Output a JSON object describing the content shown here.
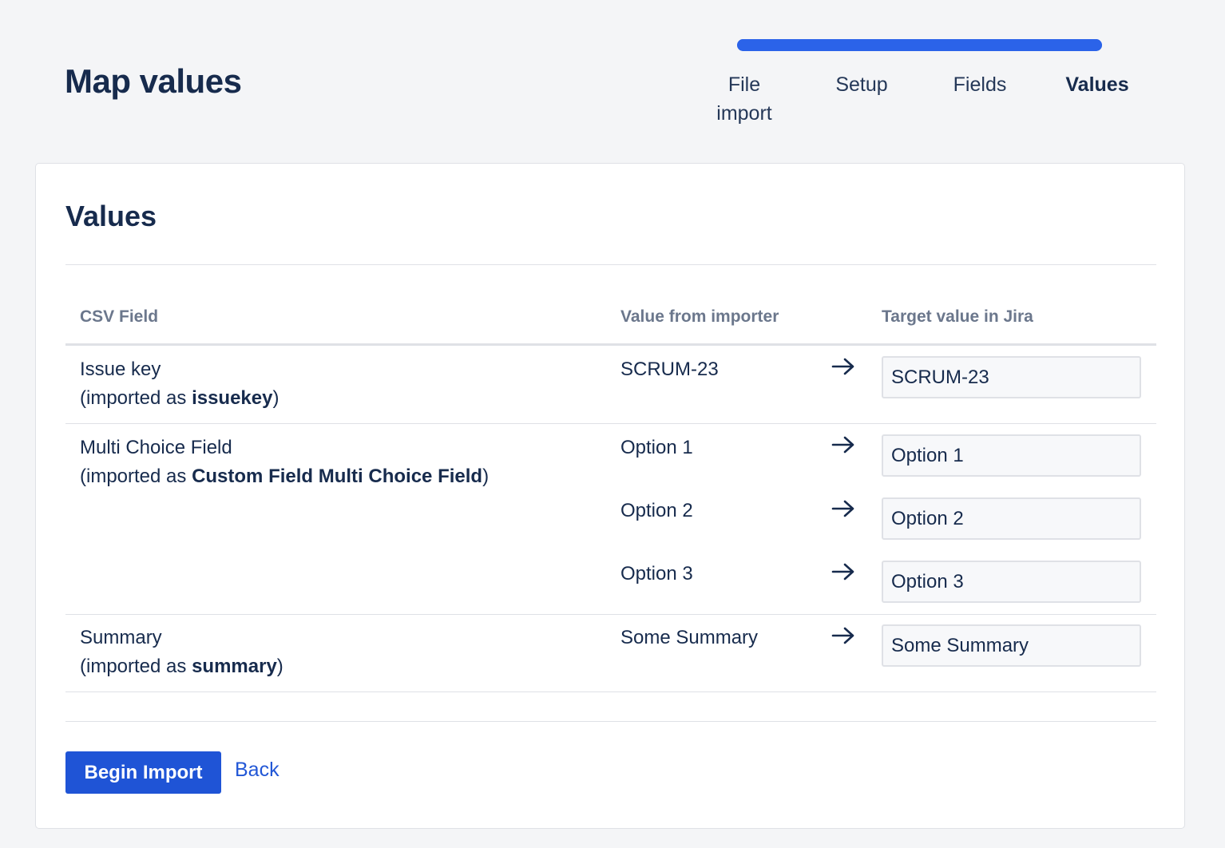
{
  "page": {
    "title": "Map values"
  },
  "progress": {
    "fraction": 1.0,
    "color": "#2b63e9"
  },
  "steps": [
    {
      "label_line1": "File",
      "label_line2": "import",
      "current": false
    },
    {
      "label_line1": "Setup",
      "label_line2": "",
      "current": false
    },
    {
      "label_line1": "Fields",
      "label_line2": "",
      "current": false
    },
    {
      "label_line1": "Values",
      "label_line2": "",
      "current": true
    }
  ],
  "card": {
    "title": "Values",
    "columns": [
      "CSV Field",
      "Value from importer",
      "Target value in Jira"
    ],
    "rows": [
      {
        "field": "Issue key",
        "imported_prefix": "(imported as ",
        "imported_name": "issuekey",
        "imported_suffix": ")",
        "mappings": [
          {
            "source": "SCRUM-23",
            "target": "SCRUM-23"
          }
        ]
      },
      {
        "field": "Multi Choice Field",
        "imported_prefix": "(imported as ",
        "imported_name": "Custom Field Multi Choice Field",
        "imported_suffix": ")",
        "mappings": [
          {
            "source": "Option 1",
            "target": "Option 1"
          },
          {
            "source": "Option 2",
            "target": "Option 2"
          },
          {
            "source": "Option 3",
            "target": "Option 3"
          }
        ]
      },
      {
        "field": "Summary",
        "imported_prefix": "(imported as ",
        "imported_name": "summary",
        "imported_suffix": ")",
        "mappings": [
          {
            "source": "Some Summary",
            "target": "Some Summary"
          }
        ]
      }
    ],
    "arrow_icon": "arrow-right-icon"
  },
  "actions": {
    "primary_label": "Begin Import",
    "back_label": "Back"
  }
}
